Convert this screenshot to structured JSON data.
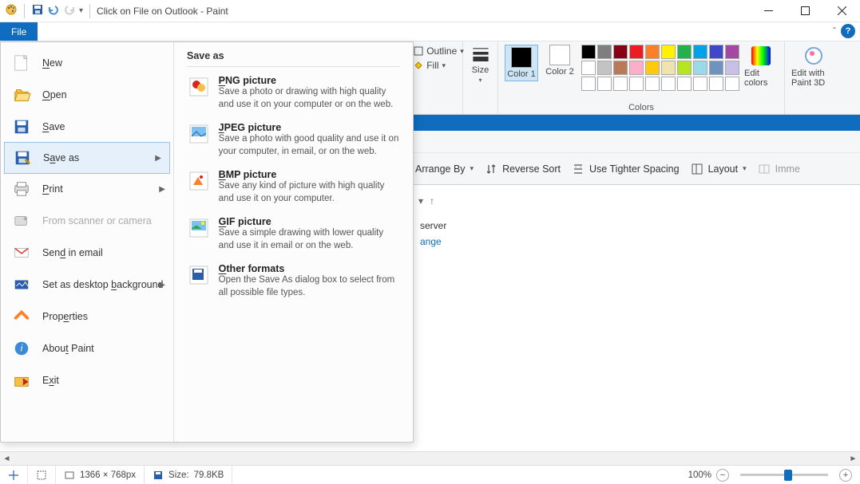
{
  "titlebar": {
    "title": "Click on File on Outlook - Paint"
  },
  "file_tab": "File",
  "file_menu": {
    "items": [
      {
        "label": "New",
        "u": "N"
      },
      {
        "label": "Open",
        "u": "O"
      },
      {
        "label": "Save",
        "u": "S"
      },
      {
        "label": "Save as",
        "u": "a",
        "arrow": true,
        "hover": true
      },
      {
        "label": "Print",
        "u": "P",
        "arrow": true
      },
      {
        "label": "From scanner or camera",
        "u": "",
        "disabled": true
      },
      {
        "label": "Send in email",
        "u": "d"
      },
      {
        "label": "Set as desktop background",
        "u": "b",
        "arrow": true
      },
      {
        "label": "Properties",
        "u": "e"
      },
      {
        "label": "About Paint",
        "u": "t"
      },
      {
        "label": "Exit",
        "u": "x"
      }
    ],
    "save_as_header": "Save as",
    "save_as": [
      {
        "title": "PNG picture",
        "u": "P",
        "desc": "Save a photo or drawing with high quality and use it on your computer or on the web."
      },
      {
        "title": "JPEG picture",
        "u": "J",
        "desc": "Save a photo with good quality and use it on your computer, in email, or on the web."
      },
      {
        "title": "BMP picture",
        "u": "B",
        "desc": "Save any kind of picture with high quality and use it on your computer."
      },
      {
        "title": "GIF picture",
        "u": "G",
        "desc": "Save a simple drawing with lower quality and use it in email or on the web."
      },
      {
        "title": "Other formats",
        "u": "O",
        "desc": "Open the Save As dialog box to select from all possible file types."
      }
    ]
  },
  "ribbon": {
    "outline": "Outline",
    "fill": "Fill",
    "size": "Size",
    "color1": "Color 1",
    "color2": "Color 2",
    "edit_colors": "Edit colors",
    "edit_3d": "Edit with Paint 3D",
    "colors_label": "Colors",
    "palette_row1": [
      "#000000",
      "#7f7f7f",
      "#880015",
      "#ed1c24",
      "#ff7f27",
      "#fff200",
      "#22b14c",
      "#00a2e8",
      "#3f48cc",
      "#a349a4"
    ],
    "palette_row2": [
      "#ffffff",
      "#c3c3c3",
      "#b97a57",
      "#ffaec9",
      "#ffc90e",
      "#efe4b0",
      "#b5e61d",
      "#99d9ea",
      "#7092be",
      "#c8bfe7"
    ],
    "palette_row3": [
      "#ffffff",
      "#ffffff",
      "#ffffff",
      "#ffffff",
      "#ffffff",
      "#ffffff",
      "#ffffff",
      "#ffffff",
      "#ffffff",
      "#ffffff"
    ]
  },
  "toolbar2": {
    "arrange": "Arrange By",
    "reverse": "Reverse Sort",
    "tighter": "Use Tighter Spacing",
    "layout": "Layout",
    "imme": "Imme"
  },
  "mid": {
    "server": "server",
    "change": "ange"
  },
  "status": {
    "dims": "1366 × 768px",
    "size_label": "Size:",
    "size_val": "79.8KB",
    "zoom": "100%"
  }
}
